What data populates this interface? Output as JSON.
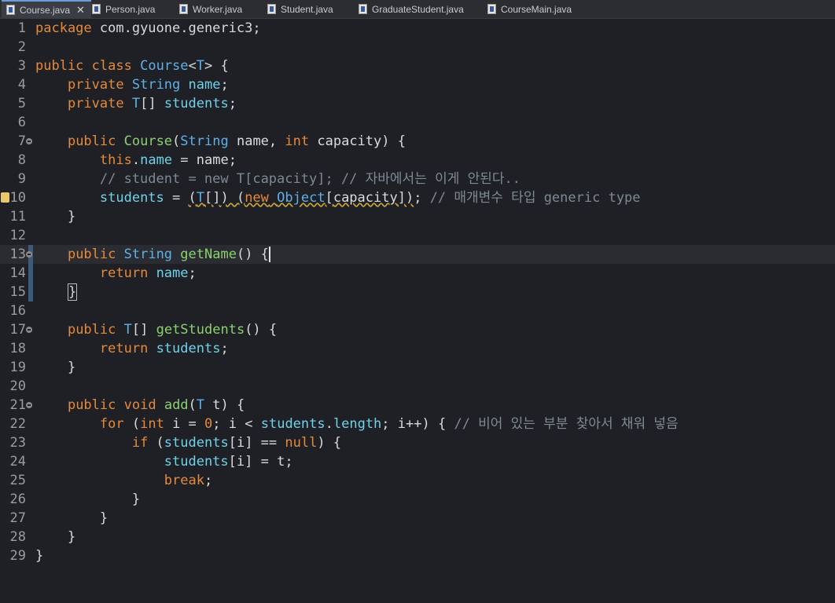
{
  "tabs": [
    {
      "label": "Course.java",
      "active": true,
      "closable": true
    },
    {
      "label": "Person.java"
    },
    {
      "label": "Worker.java"
    },
    {
      "label": "Student.java"
    },
    {
      "label": "GraduateStudent.java"
    },
    {
      "label": "CourseMain.java"
    }
  ],
  "icons": {
    "file": "java-file-icon",
    "close": "close-icon",
    "fold": "fold-collapse-icon",
    "warning": "warning-icon"
  },
  "colors": {
    "background": "#1e2025",
    "keyword": "#e58a3a",
    "type": "#5fb0e6",
    "field": "#6fd2e8",
    "method": "#8bd16f",
    "comment": "#7d8a94",
    "line_number": "#9c9c9c"
  },
  "editor": {
    "line_numbers": [
      "1",
      "2",
      "3",
      "4",
      "5",
      "6",
      "7",
      "8",
      "9",
      "10",
      "11",
      "12",
      "13",
      "14",
      "15",
      "16",
      "17",
      "18",
      "19",
      "20",
      "21",
      "22",
      "23",
      "24",
      "25",
      "26",
      "27",
      "28",
      "29"
    ],
    "lines": [
      "package com.gyuone.generic3;",
      "",
      "public class Course<T> {",
      "    private String name;",
      "    private T[] students;",
      "",
      "    public Course(String name, int capacity) {",
      "        this.name = name;",
      "        // student = new T[capacity]; // 자바에서는 이게 안된다..",
      "        students = (T[]) (new Object[capacity]); // 매개변수 타입 generic type",
      "    }",
      "",
      "    public String getName() {",
      "        return name;",
      "    }",
      "",
      "    public T[] getStudents() {",
      "        return students;",
      "    }",
      "",
      "    public void add(T t) {",
      "        for (int i = 0; i < students.length; i++) { // 비어 있는 부분 찾아서 채워 넣음",
      "            if (students[i] == null) {",
      "                students[i] = t;",
      "                break;",
      "            }",
      "        }",
      "    }",
      "}"
    ]
  }
}
